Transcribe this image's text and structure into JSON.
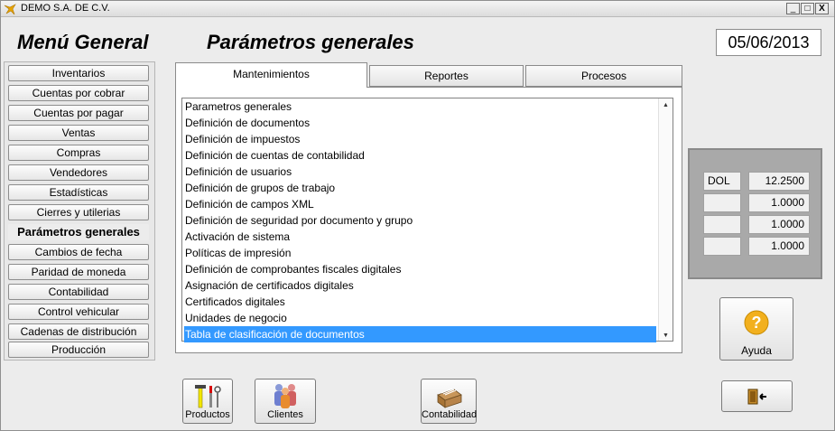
{
  "window": {
    "title": "DEMO  S.A. DE C.V.",
    "controls": [
      "_",
      "□",
      "X"
    ]
  },
  "header": {
    "menu_title": "Menú General",
    "section_title": "Parámetros generales",
    "date": "05/06/2013"
  },
  "menu": {
    "items": [
      {
        "label": "Inventarios",
        "active": false
      },
      {
        "label": "Cuentas por cobrar",
        "active": false
      },
      {
        "label": "Cuentas por pagar",
        "active": false
      },
      {
        "label": "Ventas",
        "active": false
      },
      {
        "label": "Compras",
        "active": false
      },
      {
        "label": "Vendedores",
        "active": false
      },
      {
        "label": "Estadísticas",
        "active": false
      },
      {
        "label": "Cierres y utilerias",
        "active": false
      },
      {
        "label": "Parámetros generales",
        "active": true
      },
      {
        "label": "Cambios de fecha",
        "active": false
      },
      {
        "label": "Paridad de moneda",
        "active": false
      },
      {
        "label": "Contabilidad",
        "active": false
      },
      {
        "label": "Control vehicular",
        "active": false
      },
      {
        "label": "Cadenas de distribución",
        "active": false
      },
      {
        "label": "Producción",
        "active": false
      }
    ]
  },
  "tabs": [
    {
      "label": "Mantenimientos",
      "selected": true
    },
    {
      "label": "Reportes",
      "selected": false
    },
    {
      "label": "Procesos",
      "selected": false
    }
  ],
  "list": {
    "items": [
      "Parametros generales",
      "Definición de documentos",
      "Definición de impuestos",
      "Definición de cuentas de contabilidad",
      "Definición de usuarios",
      "Definición de grupos de trabajo",
      "Definición de campos XML",
      "Definición de seguridad por documento y grupo",
      "Activación  de sistema",
      "Políticas de  impresión",
      "Definición de comprobantes fiscales digitales",
      "Asignación de certificados digitales",
      "Certificados digitales",
      "Unidades de negocio",
      "Tabla de clasificación de documentos"
    ],
    "selected_index": 14
  },
  "rates": [
    {
      "code": "DOL",
      "value": "12.2500"
    },
    {
      "code": "",
      "value": "1.0000"
    },
    {
      "code": "",
      "value": "1.0000"
    },
    {
      "code": "",
      "value": "1.0000"
    }
  ],
  "buttons": {
    "help_label": "Ayuda",
    "products_label": "Productos",
    "clients_label": "Clientes",
    "accounting_label": "Contabilidad"
  },
  "colors": {
    "selection": "#3399ff",
    "help_icon": "#f2b01e"
  }
}
